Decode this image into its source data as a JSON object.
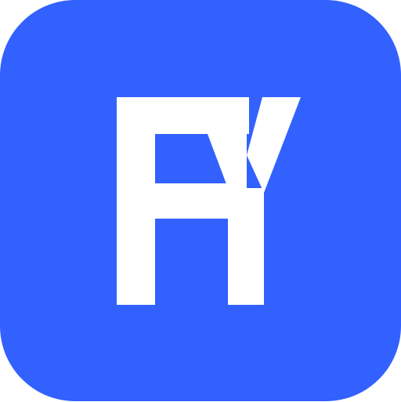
{
  "app_icon": {
    "monogram": "FY",
    "background_color": "#3361FF",
    "glyph_color": "#FFFFFF",
    "icon_name": "fy-monogram-app-icon"
  }
}
